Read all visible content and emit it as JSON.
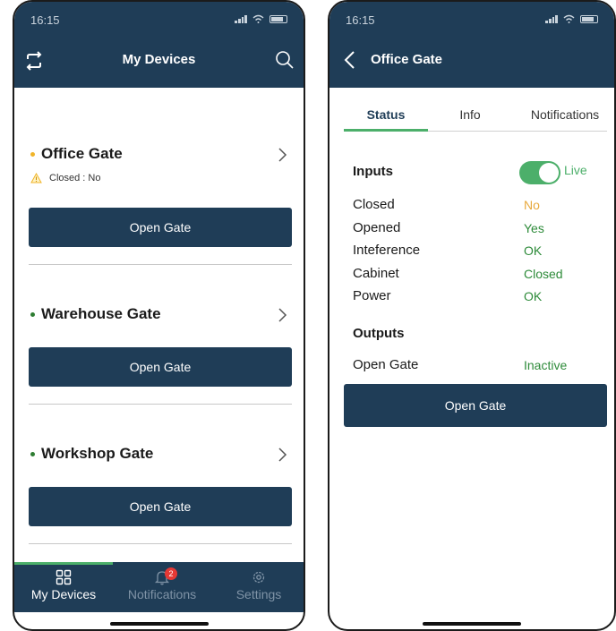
{
  "phone1": {
    "status_time": "16:15",
    "title": "My Devices",
    "devices": [
      {
        "name": "Office Gate",
        "status_dot_color": "#f0b429",
        "warning_text": "Closed : No",
        "button": "Open Gate"
      },
      {
        "name": "Warehouse Gate",
        "status_dot_color": "#2e7d32",
        "button": "Open Gate"
      },
      {
        "name": "Workshop Gate",
        "status_dot_color": "#2e7d32",
        "button": "Open Gate"
      }
    ],
    "tabbar": {
      "items": [
        {
          "label": "My Devices",
          "icon": "grid-icon",
          "active": true
        },
        {
          "label": "Notifications",
          "icon": "bell-icon",
          "badge": "2"
        },
        {
          "label": "Settings",
          "icon": "gear-icon"
        }
      ]
    }
  },
  "phone2": {
    "status_time": "16:15",
    "title": "Office Gate",
    "tabs": [
      {
        "label": "Status",
        "active": true
      },
      {
        "label": "Info"
      },
      {
        "label": "Notifications"
      }
    ],
    "inputs": {
      "title": "Inputs",
      "live_label": "Live",
      "live_on": true,
      "rows": [
        {
          "label": "Closed",
          "value": "No",
          "color": "#e8a93c"
        },
        {
          "label": "Opened",
          "value": "Yes",
          "color": "#2e8b3a"
        },
        {
          "label": "Inteference",
          "value": "OK",
          "color": "#2e8b3a"
        },
        {
          "label": "Cabinet",
          "value": "Closed",
          "color": "#2e8b3a"
        },
        {
          "label": "Power",
          "value": "OK",
          "color": "#2e8b3a"
        }
      ]
    },
    "outputs": {
      "title": "Outputs",
      "rows": [
        {
          "label": "Open Gate",
          "value": "Inactive",
          "color": "#2e8b3a"
        }
      ]
    },
    "button": "Open Gate"
  },
  "colors": {
    "header": "#1f3d57",
    "accent_green": "#4caf6a",
    "warning_yellow": "#f0b429"
  }
}
